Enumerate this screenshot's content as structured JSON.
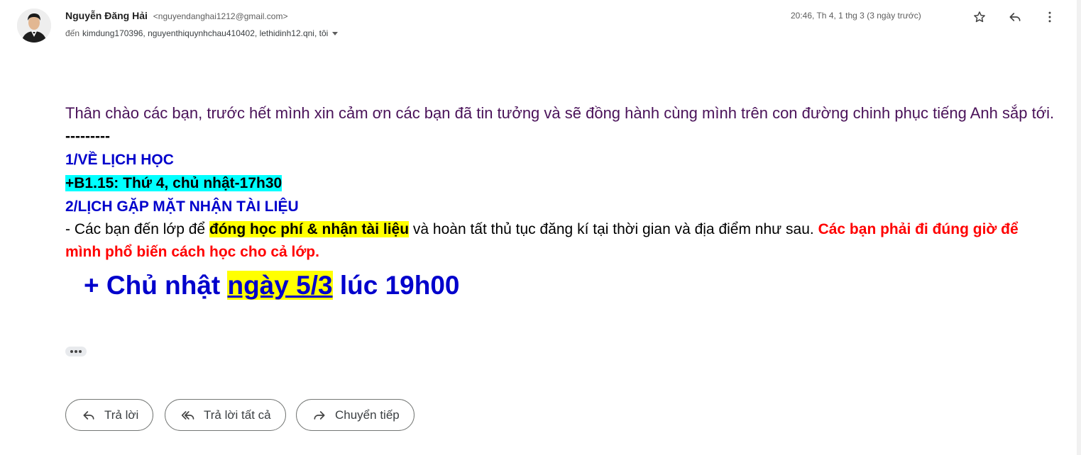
{
  "header": {
    "sender_name": "Nguyễn Đăng Hải",
    "sender_email": "<nguyendanghai1212@gmail.com>",
    "recipients_prefix": "đến",
    "recipients": "kimdung170396, nguyenthiquynhchau410402, lethidinh12.qni, tôi",
    "timestamp": "20:46, Th 4, 1 thg 3 (3 ngày trước)",
    "icons": [
      "star-icon",
      "reply-icon",
      "more-vert-icon"
    ]
  },
  "body": {
    "greeting": "Thân chào các bạn, trước hết mình xin cảm ơn các bạn đã tin tưởng và sẽ đồng hành cùng mình trên con đường chinh phục tiếng Anh sắp tới.",
    "dashes": "---------",
    "section1_title": "1/VỀ LỊCH HỌC",
    "schedule": "+B1.15: Thứ 4, chủ nhật-17h30",
    "section2_title": "2/LỊCH GẶP MẶT NHẬN TÀI LIỆU",
    "instr_prefix": "- Các bạn đến lớp để ",
    "instr_highlight": "đóng học phí & nhận tài liệu",
    "instr_middle": " và hoàn tất thủ tục đăng kí tại thời gian và địa điểm như sau. ",
    "instr_warning": "Các bạn phải đi đúng giờ để mình phổ biến cách học cho cả lớp.",
    "meeting_prefix": "+ Chủ nhật ",
    "meeting_date": "ngày 5/3",
    "meeting_suffix": " lúc 19h00"
  },
  "actions": {
    "reply": "Trả lời",
    "reply_all": "Trả lời tất cả",
    "forward": "Chuyển tiếp"
  },
  "colors": {
    "greeting": "#4a1259",
    "heading_blue": "#0000cc",
    "warning_red": "#ff0000",
    "highlight_yellow": "#ffff00",
    "highlight_cyan": "#00ffff"
  }
}
